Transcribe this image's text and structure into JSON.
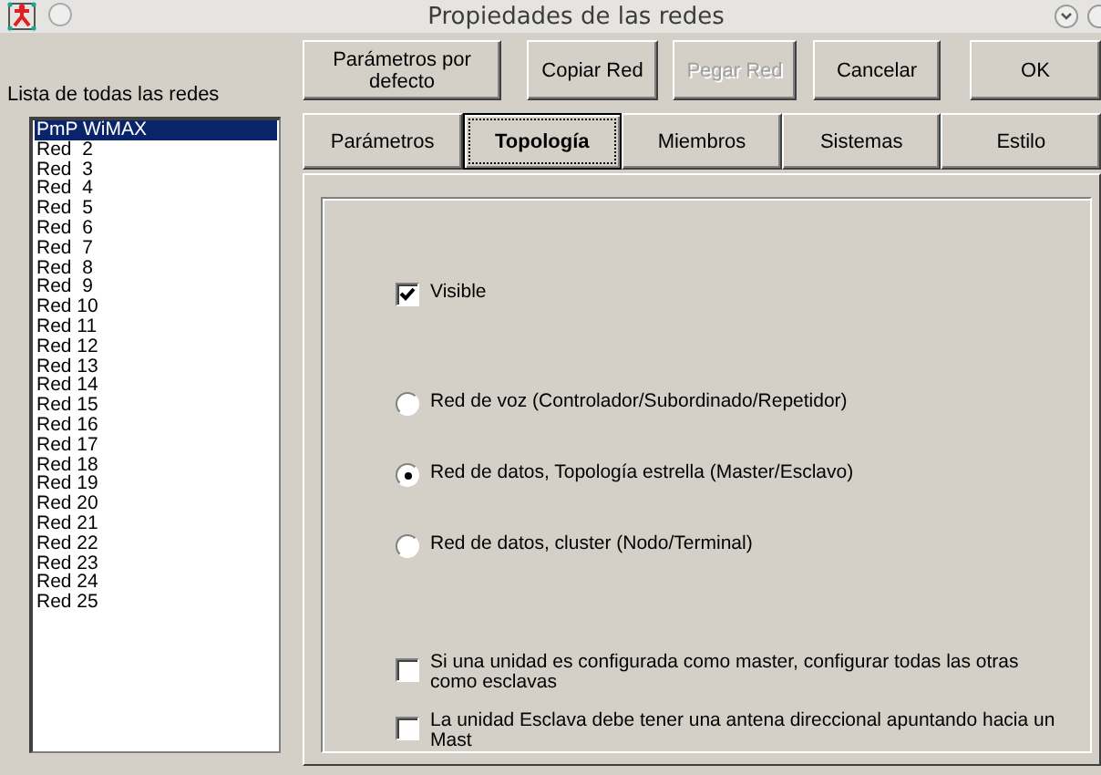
{
  "window": {
    "title": "Propiedades de las redes"
  },
  "network_list": {
    "label": "Lista de todas las redes",
    "items": [
      {
        "label": "PmP WiMAX",
        "selected": true
      },
      {
        "label": "Red  2",
        "selected": false
      },
      {
        "label": "Red  3",
        "selected": false
      },
      {
        "label": "Red  4",
        "selected": false
      },
      {
        "label": "Red  5",
        "selected": false
      },
      {
        "label": "Red  6",
        "selected": false
      },
      {
        "label": "Red  7",
        "selected": false
      },
      {
        "label": "Red  8",
        "selected": false
      },
      {
        "label": "Red  9",
        "selected": false
      },
      {
        "label": "Red 10",
        "selected": false
      },
      {
        "label": "Red 11",
        "selected": false
      },
      {
        "label": "Red 12",
        "selected": false
      },
      {
        "label": "Red 13",
        "selected": false
      },
      {
        "label": "Red 14",
        "selected": false
      },
      {
        "label": "Red 15",
        "selected": false
      },
      {
        "label": "Red 16",
        "selected": false
      },
      {
        "label": "Red 17",
        "selected": false
      },
      {
        "label": "Red 18",
        "selected": false
      },
      {
        "label": "Red 19",
        "selected": false
      },
      {
        "label": "Red 20",
        "selected": false
      },
      {
        "label": "Red 21",
        "selected": false
      },
      {
        "label": "Red 22",
        "selected": false
      },
      {
        "label": "Red 23",
        "selected": false
      },
      {
        "label": "Red 24",
        "selected": false
      },
      {
        "label": "Red 25",
        "selected": false
      }
    ]
  },
  "buttons": [
    {
      "label": "Parámetros por defecto",
      "disabled": false
    },
    {
      "label": "Copiar Red",
      "disabled": false
    },
    {
      "label": "Pegar Red",
      "disabled": true
    },
    {
      "label": "Cancelar",
      "disabled": false
    },
    {
      "label": "OK",
      "disabled": false
    }
  ],
  "tabs": [
    {
      "label": "Parámetros",
      "selected": false
    },
    {
      "label": "Topología",
      "selected": true
    },
    {
      "label": "Miembros",
      "selected": false
    },
    {
      "label": "Sistemas",
      "selected": false
    },
    {
      "label": "Estilo",
      "selected": false
    }
  ],
  "topology": {
    "visible": {
      "label": "Visible",
      "checked": true
    },
    "network_types": [
      {
        "label": "Red de voz (Controlador/Subordinado/Repetidor)",
        "selected": false
      },
      {
        "label": "Red de datos, Topología estrella (Master/Esclavo)",
        "selected": true
      },
      {
        "label": "Red de datos, cluster (Nodo/Terminal)",
        "selected": false
      }
    ],
    "options": [
      {
        "label": "Si una unidad es configurada como master, configurar todas las otras como esclavas",
        "checked": false
      },
      {
        "label": "La unidad Esclava debe tener una antena direccional apuntando hacia un Mast",
        "checked": false
      }
    ]
  }
}
